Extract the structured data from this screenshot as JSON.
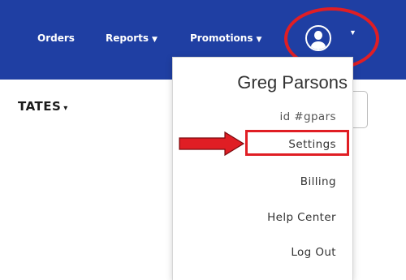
{
  "nav": {
    "items": [
      {
        "label": "Orders",
        "has_caret": false
      },
      {
        "label": "Reports",
        "has_caret": true
      },
      {
        "label": "Promotions",
        "has_caret": true
      }
    ],
    "account_icon": "user-avatar-icon",
    "account_caret_icon": "caret-down-icon"
  },
  "page": {
    "partial_label": "TATES",
    "partial_label_icon": "caret-down-icon"
  },
  "dropdown": {
    "user_name": "Greg Parsons",
    "user_id": "id #gpars",
    "items": [
      {
        "label": "Settings",
        "highlighted": true
      },
      {
        "label": "Billing",
        "highlighted": false
      },
      {
        "label": "Help Center",
        "highlighted": false
      },
      {
        "label": "Log Out",
        "highlighted": false
      }
    ]
  },
  "annotations": {
    "pointer_arrow_icon": "right-arrow-icon"
  },
  "colors": {
    "nav_background": "#1f3fa3",
    "annotation_red": "#e01e24",
    "menu_text": "#333333"
  }
}
